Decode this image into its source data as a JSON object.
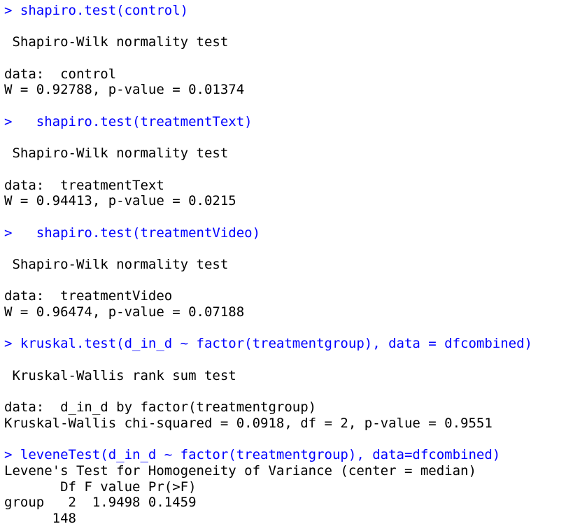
{
  "console": {
    "lines": [
      {
        "kind": "cmd",
        "text": "> shapiro.test(control)"
      },
      {
        "kind": "out",
        "text": ""
      },
      {
        "kind": "out",
        "text": " Shapiro-Wilk normality test"
      },
      {
        "kind": "out",
        "text": ""
      },
      {
        "kind": "out",
        "text": "data:  control"
      },
      {
        "kind": "out",
        "text": "W = 0.92788, p-value = 0.01374"
      },
      {
        "kind": "out",
        "text": ""
      },
      {
        "kind": "cmd",
        "text": ">   shapiro.test(treatmentText)"
      },
      {
        "kind": "out",
        "text": ""
      },
      {
        "kind": "out",
        "text": " Shapiro-Wilk normality test"
      },
      {
        "kind": "out",
        "text": ""
      },
      {
        "kind": "out",
        "text": "data:  treatmentText"
      },
      {
        "kind": "out",
        "text": "W = 0.94413, p-value = 0.0215"
      },
      {
        "kind": "out",
        "text": ""
      },
      {
        "kind": "cmd",
        "text": ">   shapiro.test(treatmentVideo)"
      },
      {
        "kind": "out",
        "text": ""
      },
      {
        "kind": "out",
        "text": " Shapiro-Wilk normality test"
      },
      {
        "kind": "out",
        "text": ""
      },
      {
        "kind": "out",
        "text": "data:  treatmentVideo"
      },
      {
        "kind": "out",
        "text": "W = 0.96474, p-value = 0.07188"
      },
      {
        "kind": "out",
        "text": ""
      },
      {
        "kind": "cmd",
        "text": "> kruskal.test(d_in_d ~ factor(treatmentgroup), data = dfcombined)"
      },
      {
        "kind": "out",
        "text": ""
      },
      {
        "kind": "out",
        "text": " Kruskal-Wallis rank sum test"
      },
      {
        "kind": "out",
        "text": ""
      },
      {
        "kind": "out",
        "text": "data:  d_in_d by factor(treatmentgroup)"
      },
      {
        "kind": "out",
        "text": "Kruskal-Wallis chi-squared = 0.0918, df = 2, p-value = 0.9551"
      },
      {
        "kind": "out",
        "text": ""
      },
      {
        "kind": "cmd",
        "text": "> leveneTest(d_in_d ~ factor(treatmentgroup), data=dfcombined)"
      },
      {
        "kind": "out",
        "text": "Levene's Test for Homogeneity of Variance (center = median)"
      },
      {
        "kind": "out",
        "text": "       Df F value Pr(>F)"
      },
      {
        "kind": "out",
        "text": "group   2  1.9498 0.1459"
      },
      {
        "kind": "out",
        "text": "      148"
      }
    ]
  },
  "colors": {
    "command": "#0000ff",
    "output": "#000000",
    "background": "#ffffff"
  }
}
